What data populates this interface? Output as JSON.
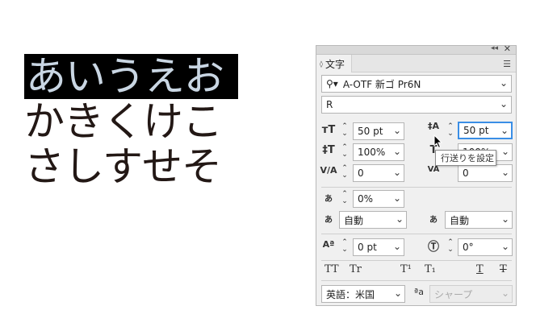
{
  "artboard": {
    "line1": "あいうえお",
    "line2": "かきくけこ",
    "line3": "さしすせそ"
  },
  "panel": {
    "tab_label": "文字",
    "font_family": "A-OTF 新ゴ Pr6N",
    "font_style": "R",
    "font_size": "50 pt",
    "leading": "50 pt",
    "vertical_scale": "100%",
    "horizontal_scale": "100%",
    "kerning": "0",
    "tracking": "0",
    "tsume": "0%",
    "aki_left": "自動",
    "aki_right": "自動",
    "baseline_shift": "0 pt",
    "rotation": "0°",
    "language": "英語：米国",
    "antialias": "シャープ",
    "aa_icon": "ªa",
    "style_buttons": [
      "TT",
      "Tr",
      "T¹",
      "T₁",
      "T",
      "T"
    ]
  },
  "tooltip": {
    "text": "行送りを設定"
  }
}
